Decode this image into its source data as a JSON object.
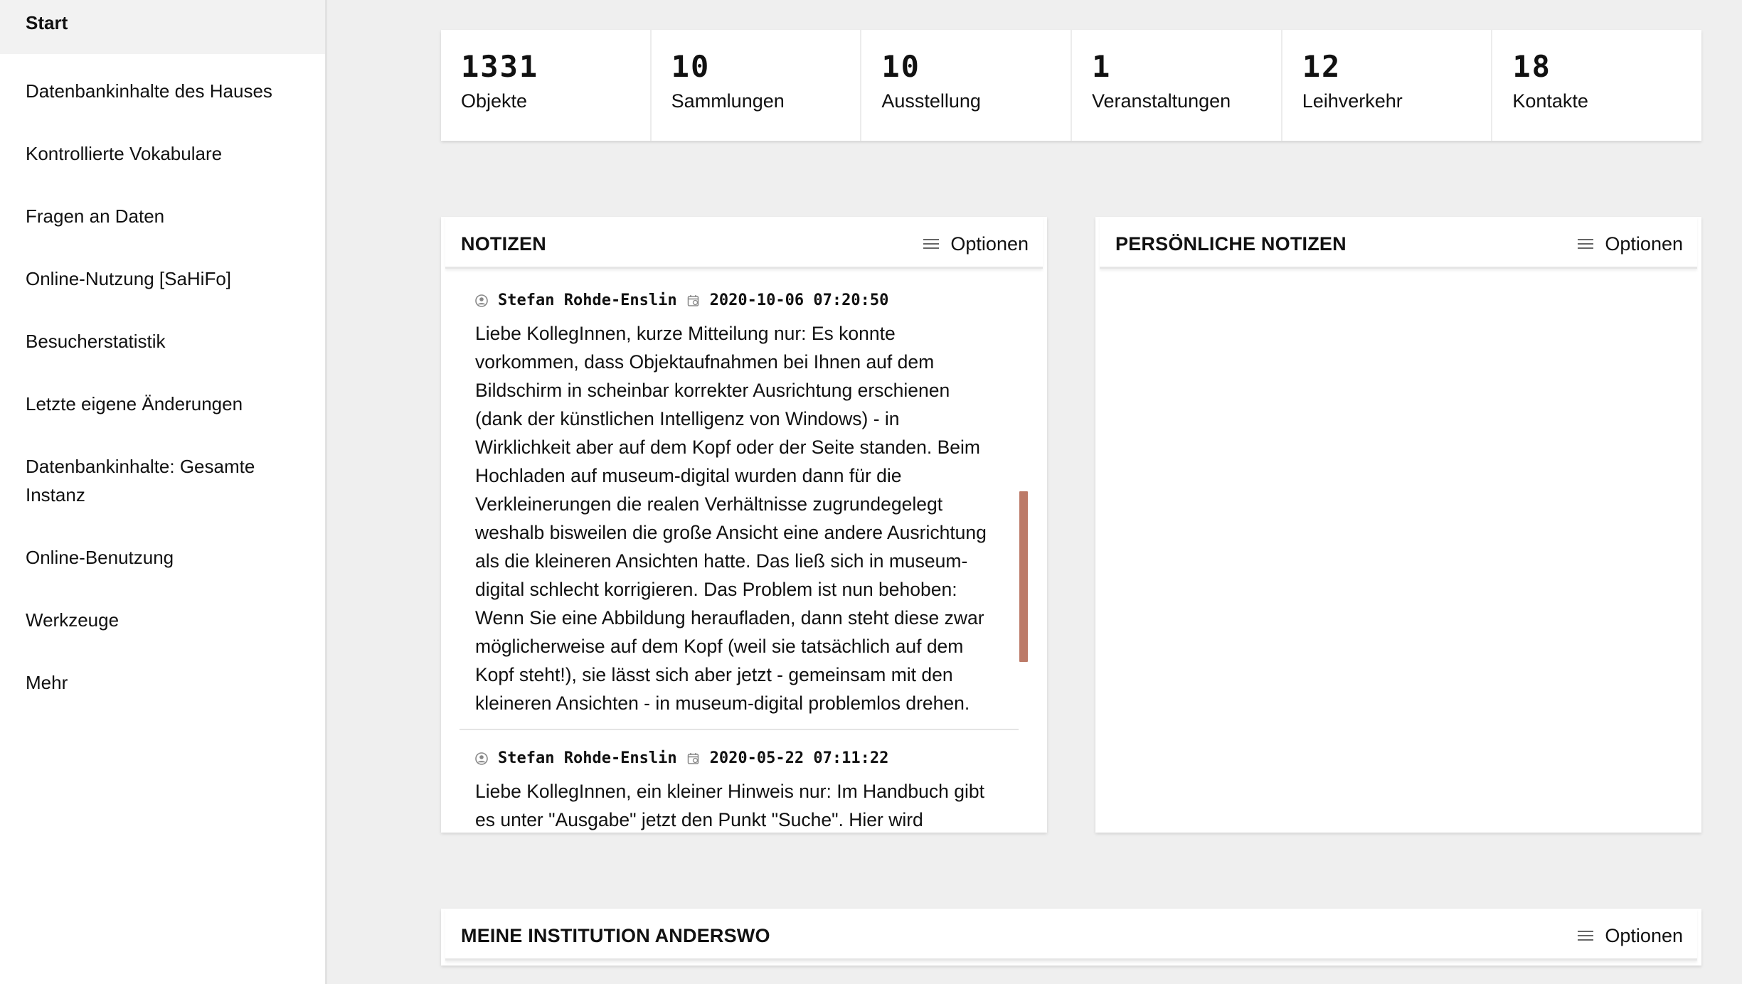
{
  "sidebar": {
    "items": [
      {
        "label": "Start"
      },
      {
        "label": "Datenbankinhalte des Hauses"
      },
      {
        "label": "Kontrollierte Vokabulare"
      },
      {
        "label": "Fragen an Daten"
      },
      {
        "label": "Online-Nutzung [SaHiFo]"
      },
      {
        "label": "Besucherstatistik"
      },
      {
        "label": "Letzte eigene Änderungen"
      },
      {
        "label": "Datenbankinhalte: Gesamte Instanz"
      },
      {
        "label": "Online-Benutzung"
      },
      {
        "label": "Werkzeuge"
      },
      {
        "label": "Mehr"
      }
    ]
  },
  "stats": [
    {
      "value": "1331",
      "label": "Objekte"
    },
    {
      "value": "10",
      "label": "Sammlungen"
    },
    {
      "value": "10",
      "label": "Ausstellung"
    },
    {
      "value": "1",
      "label": "Veranstaltungen"
    },
    {
      "value": "12",
      "label": "Leihverkehr"
    },
    {
      "value": "18",
      "label": "Kontakte"
    }
  ],
  "notes_card": {
    "title": "NOTIZEN",
    "options_label": "Optionen",
    "notes": [
      {
        "author": "Stefan Rohde-Enslin",
        "datetime": "2020-10-06 07:20:50",
        "text": "Liebe KollegInnen, kurze Mitteilung nur: Es konnte vorkommen, dass Objektaufnahmen bei Ihnen auf dem Bildschirm in scheinbar korrekter Ausrichtung erschienen (dank der künstlichen Intelligenz von Windows) - in Wirklichkeit aber auf dem Kopf oder der Seite standen. Beim Hochladen auf museum-digital wurden dann für die Verkleinerungen die realen Verhältnisse zugrundegelegt weshalb bisweilen die große Ansicht eine andere Ausrichtung als die kleineren Ansichten hatte. Das ließ sich in museum-digital schlecht korrigieren. Das Problem ist nun behoben: Wenn Sie eine Abbildung heraufladen, dann steht diese zwar möglicherweise auf dem Kopf (weil sie tatsächlich auf dem Kopf steht!), sie lässt sich aber jetzt - gemeinsam mit den kleineren Ansichten - in museum-digital problemlos drehen."
      },
      {
        "author": "Stefan Rohde-Enslin",
        "datetime": "2020-05-22 07:11:22",
        "text": "Liebe KollegInnen, ein kleiner Hinweis nur: Im Handbuch gibt es unter \"Ausgabe\" jetzt den Punkt \"Suche\". Hier wird erläutert,"
      }
    ]
  },
  "personal_notes_card": {
    "title": "PERSÖNLICHE NOTIZEN",
    "options_label": "Optionen"
  },
  "institution_card": {
    "title": "MEINE INSTITUTION ANDERSWO",
    "options_label": "Optionen"
  },
  "colors": {
    "scrollbar": "#bc7a68",
    "background": "#efefef"
  }
}
